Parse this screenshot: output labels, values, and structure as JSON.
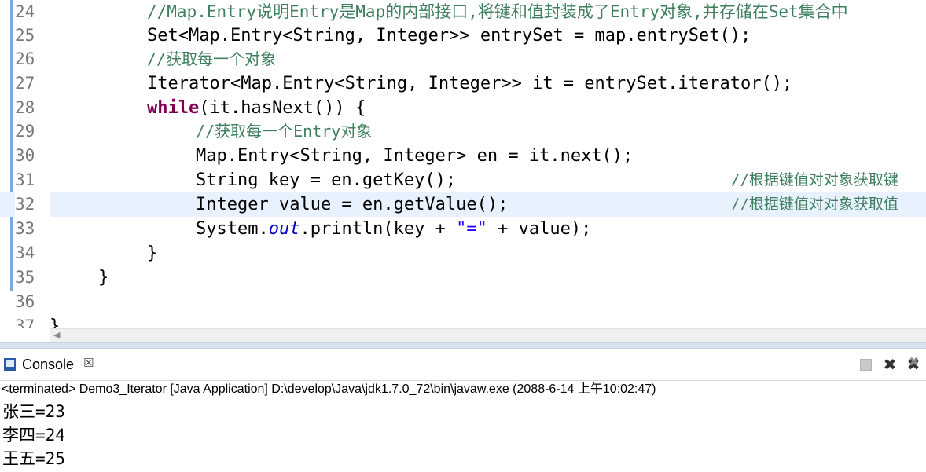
{
  "editor": {
    "lines": [
      {
        "num": "24",
        "code": "//Map.Entry说明Entry是Map的内部接口,将键和值封装成了Entry对象,并存储在Set集合中"
      },
      {
        "num": "25",
        "code": "Set<Map.Entry<String, Integer>> entrySet = map.entrySet();"
      },
      {
        "num": "26",
        "code": "//获取每一个对象"
      },
      {
        "num": "27",
        "code": "Iterator<Map.Entry<String, Integer>> it = entrySet.iterator();"
      },
      {
        "num": "28",
        "kw": "while",
        "rest": "(it.hasNext()) {"
      },
      {
        "num": "29",
        "code": "//获取每一个Entry对象"
      },
      {
        "num": "30",
        "code": "Map.Entry<String, Integer> en = it.next();"
      },
      {
        "num": "31",
        "code": "String key = en.getKey();",
        "comment": "//根据键值对对象获取键"
      },
      {
        "num": "32",
        "code": "Integer value = en.getValue();",
        "comment": "//根据键值对对象获取值"
      },
      {
        "num": "33",
        "pre": "System.",
        "field": "out",
        "mid": ".println(key + ",
        "str": "\"=\"",
        "post": " + value);"
      },
      {
        "num": "34",
        "code": "}"
      },
      {
        "num": "35",
        "code": "}"
      },
      {
        "num": "36",
        "code": ""
      },
      {
        "num": "37",
        "code": "}"
      }
    ]
  },
  "console": {
    "tab_label": "Console",
    "close_glyph": "☒",
    "status": "<terminated> Demo3_Iterator [Java Application] D:\\develop\\Java\\jdk1.7.0_72\\bin\\javaw.exe (2088-6-14 上午10:02:47)",
    "output": [
      "张三=23",
      "李四=24",
      "王五=25"
    ]
  },
  "icons": {
    "console": "console-view-icon",
    "terminate": "stop-icon",
    "remove": "remove-launch-icon",
    "remove_all": "remove-all-icon"
  },
  "colors": {
    "comment": "#3f7f5f",
    "keyword": "#7f0055",
    "field": "#0000c0",
    "string": "#2a00ff",
    "current_line": "#e8f2fe"
  }
}
